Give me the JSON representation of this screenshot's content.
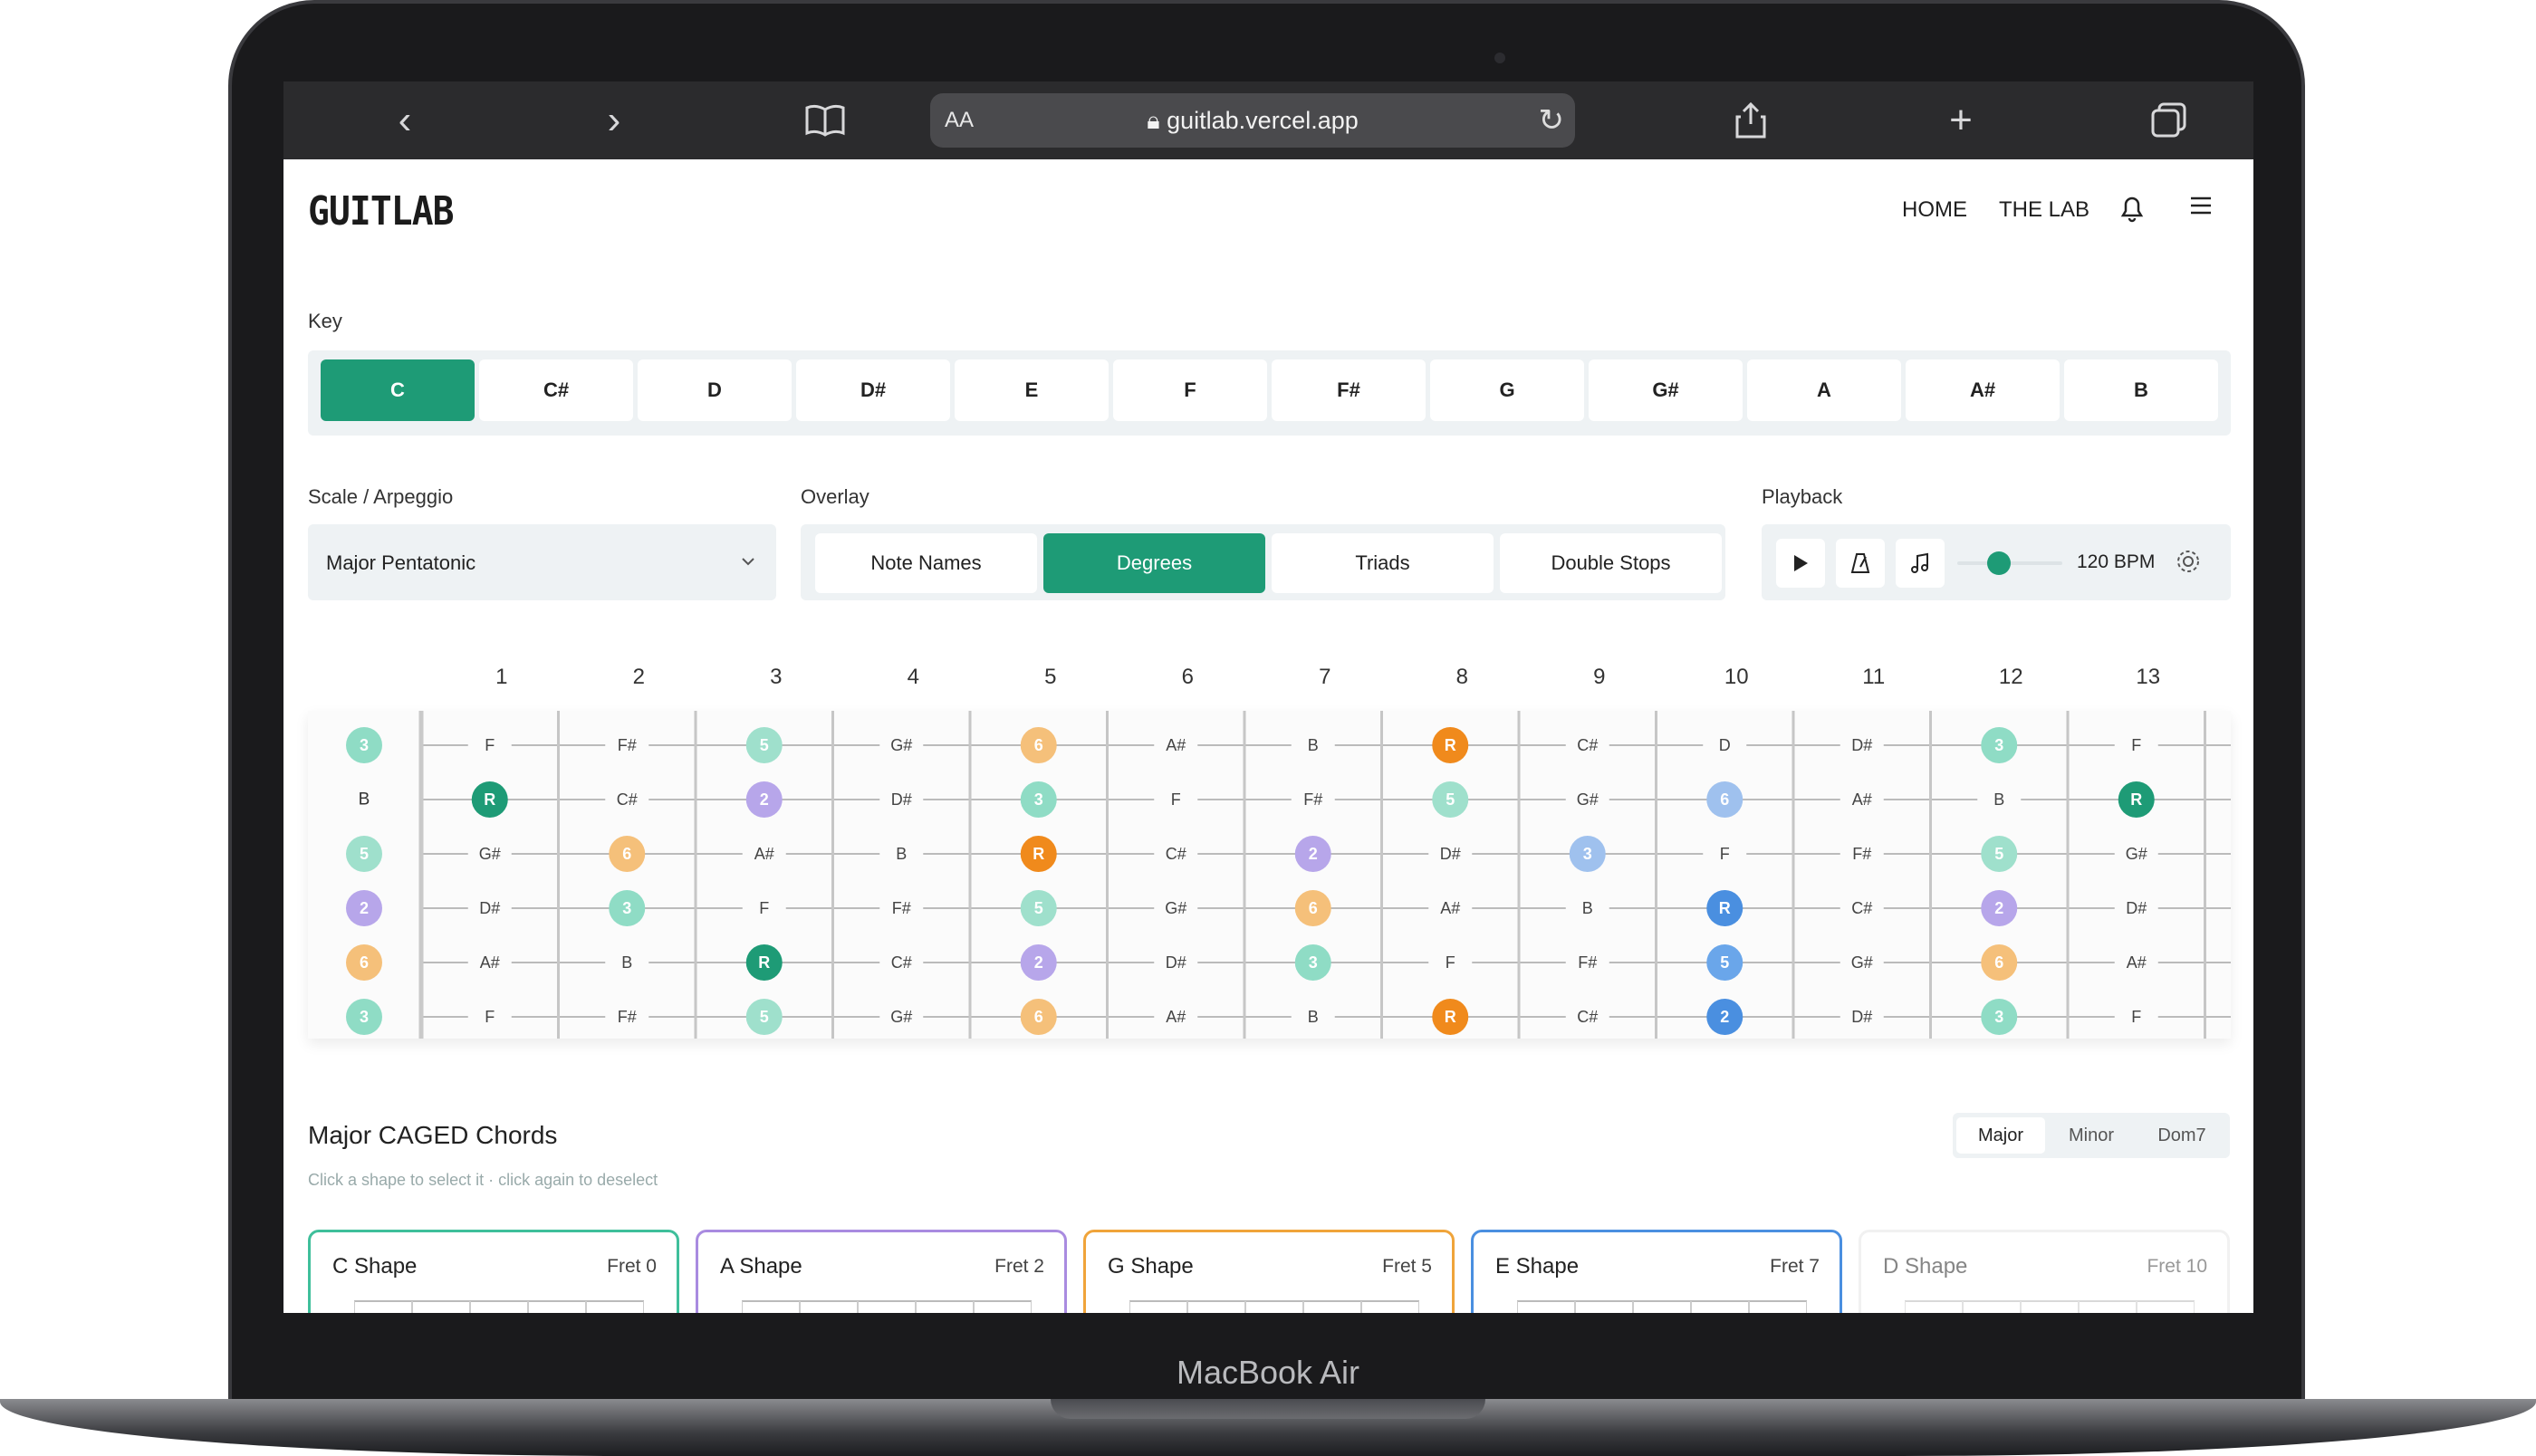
{
  "device": {
    "label": "MacBook Air"
  },
  "browser": {
    "url": "guitlab.vercel.app",
    "text_size_label": "AA",
    "icons": [
      "back-icon",
      "forward-icon",
      "bookmarks-icon",
      "lock-icon",
      "reload-icon",
      "share-icon",
      "new-tab-icon",
      "tabs-icon"
    ]
  },
  "site": {
    "logo": "GUITLAB",
    "nav": {
      "home": "HOME",
      "lab": "THE LAB"
    }
  },
  "key": {
    "label": "Key",
    "options": [
      "C",
      "C#",
      "D",
      "D#",
      "E",
      "F",
      "F#",
      "G",
      "G#",
      "A",
      "A#",
      "B"
    ],
    "selected": "C"
  },
  "scale": {
    "label": "Scale / Arpeggio",
    "value": "Major Pentatonic"
  },
  "overlay": {
    "label": "Overlay",
    "options": [
      "Note Names",
      "Degrees",
      "Triads",
      "Double Stops"
    ],
    "selected": "Degrees"
  },
  "playback": {
    "label": "Playback",
    "tempo": "120 BPM",
    "slider_level": 0.4
  },
  "fretboard": {
    "fret_numbers": [
      "1",
      "2",
      "3",
      "4",
      "5",
      "6",
      "7",
      "8",
      "9",
      "10",
      "11",
      "12",
      "13"
    ],
    "open_strings": [
      "3",
      "B",
      "5",
      "2",
      "6",
      "3"
    ],
    "strings": [
      [
        "F",
        "F#",
        "5",
        "G#",
        "6",
        "A#",
        "B",
        "R",
        "C#",
        "D",
        "D#",
        "3",
        "F"
      ],
      [
        "R",
        "C#",
        "2",
        "D#",
        "3",
        "F",
        "F#",
        "5",
        "G#",
        "6",
        "A#",
        "B",
        "R"
      ],
      [
        "G#",
        "6",
        "A#",
        "B",
        "R",
        "C#",
        "2",
        "D#",
        "3",
        "F",
        "F#",
        "5",
        "G#"
      ],
      [
        "D#",
        "3",
        "F",
        "F#",
        "5",
        "G#",
        "6",
        "A#",
        "B",
        "R",
        "C#",
        "2",
        "D#"
      ],
      [
        "A#",
        "B",
        "R",
        "C#",
        "2",
        "D#",
        "3",
        "F",
        "F#",
        "5",
        "G#",
        "6",
        "A#"
      ],
      [
        "F",
        "F#",
        "5",
        "G#",
        "6",
        "A#",
        "B",
        "R",
        "C#",
        "2",
        "D#",
        "3",
        "F"
      ]
    ]
  },
  "caged": {
    "title": "Major CAGED Chords",
    "subtitle": "Click a shape to select it · click again to deselect",
    "types": [
      "Major",
      "Minor",
      "Dom7"
    ],
    "selected_type": "Major",
    "shapes": [
      {
        "name": "C Shape",
        "fret": "Fret 0",
        "color": "#3fbf9b"
      },
      {
        "name": "A Shape",
        "fret": "Fret 2",
        "color": "#a98be0"
      },
      {
        "name": "G Shape",
        "fret": "Fret 5",
        "color": "#f0a43a"
      },
      {
        "name": "E Shape",
        "fret": "Fret 7",
        "color": "#4a8fe0"
      },
      {
        "name": "D Shape",
        "fret": "Fret 10",
        "color": "#e6e6e6"
      }
    ]
  },
  "colors": {
    "accent": "#1e9b76",
    "degree_3": "#8fdcc5",
    "degree_5": "#9fe0cc",
    "degree_2": "#b7a6ea",
    "degree_6": "#f5c07a",
    "root": "#f08a1c",
    "blue": "#4a8fe0"
  }
}
